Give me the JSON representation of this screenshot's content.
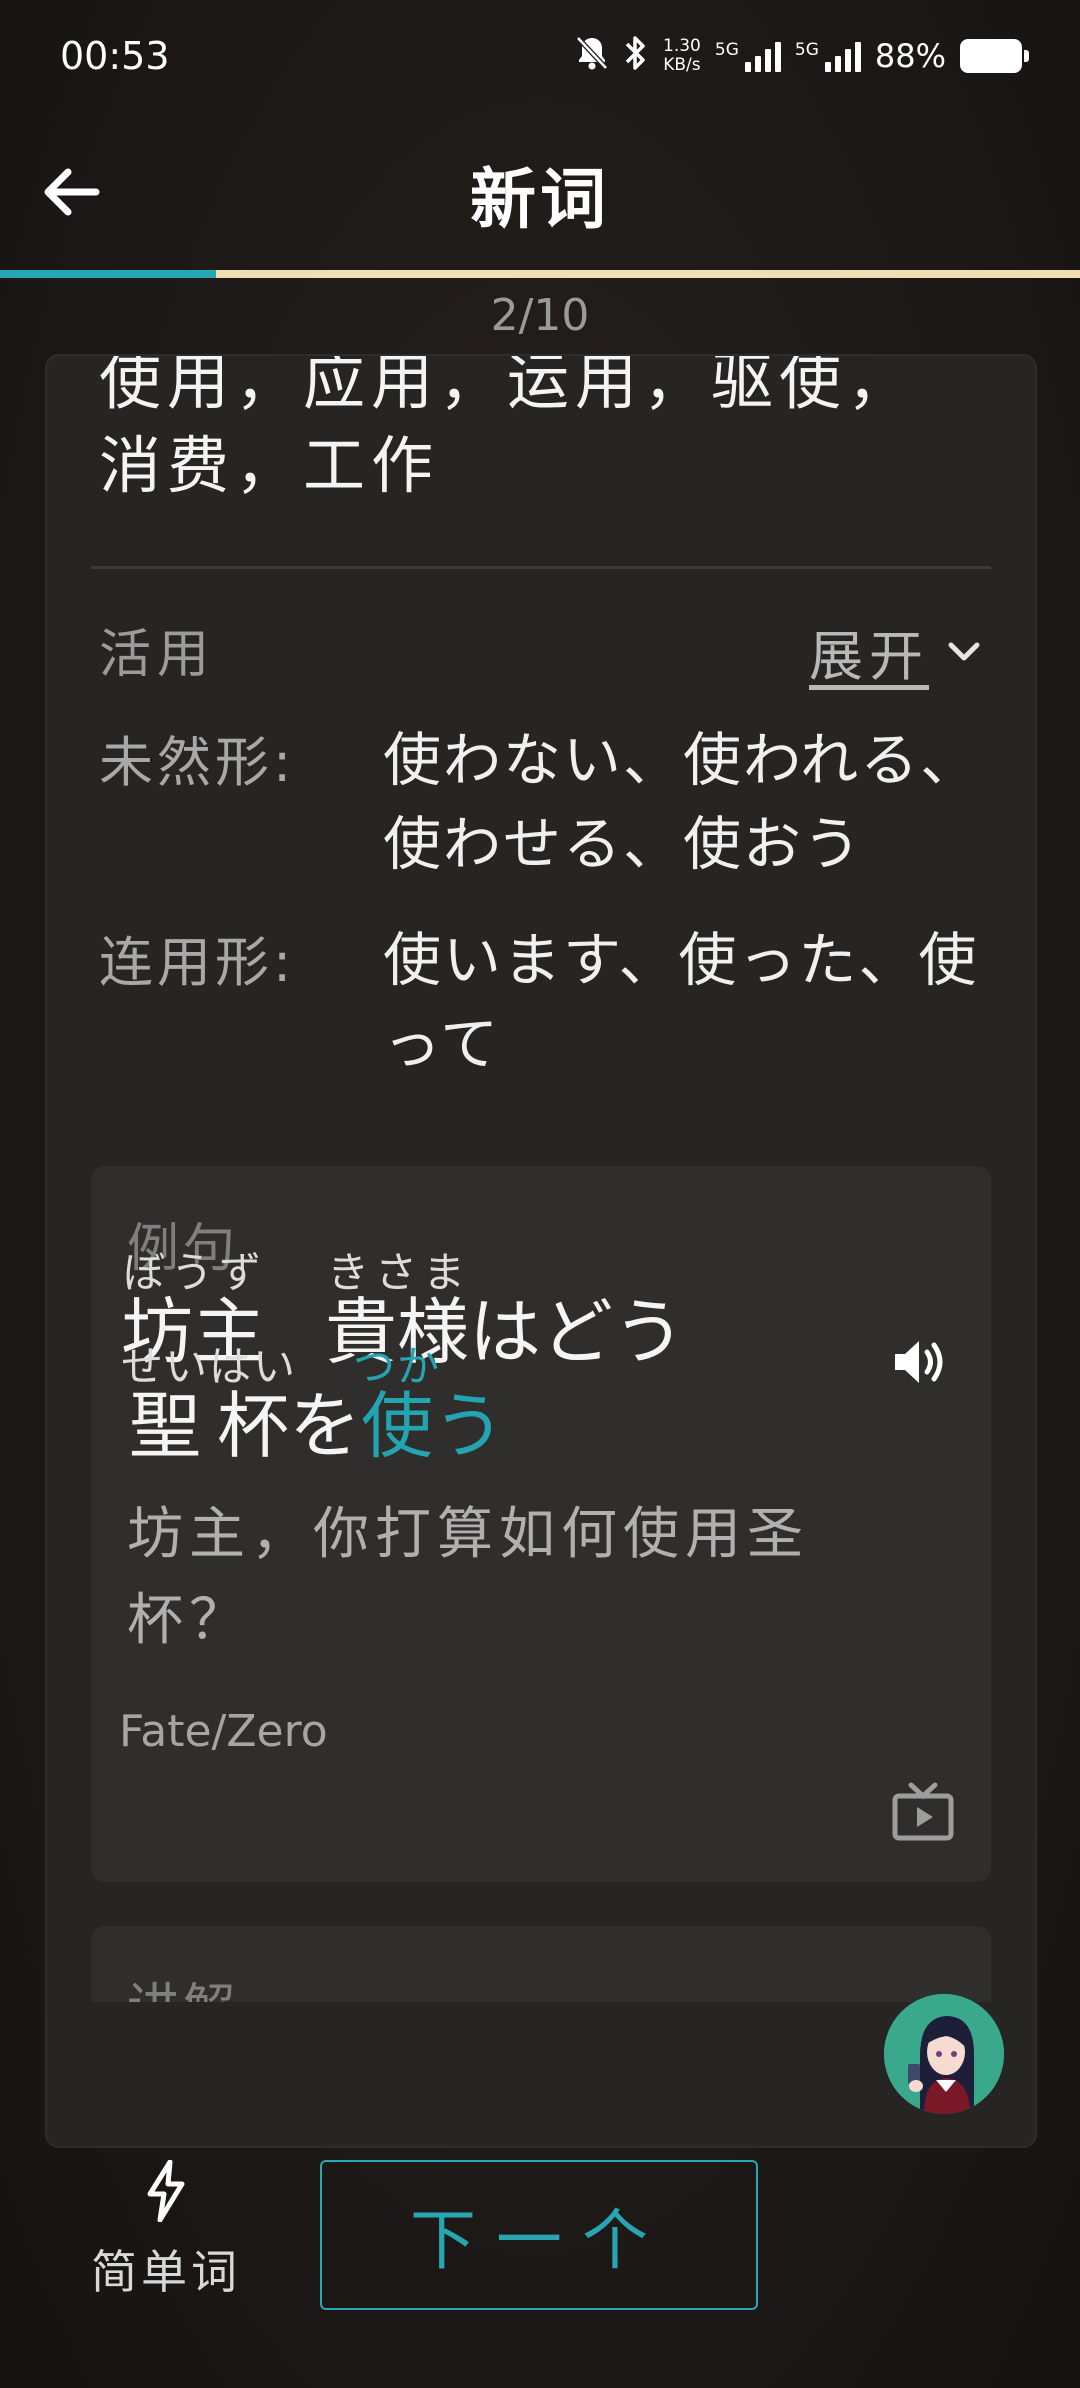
{
  "status_bar": {
    "time": "00:53",
    "speed_value": "1.30",
    "speed_unit": "KB/s",
    "sim1_label": "5G",
    "sim2_label": "5G",
    "battery": "88%"
  },
  "header": {
    "title": "新词"
  },
  "progress": {
    "fraction": 0.2,
    "counter": "2/10"
  },
  "card": {
    "meaning": "使用，应用，运用，驱使，消费，工作",
    "conjugation_section": {
      "title": "活用",
      "expand_label": "展开",
      "rows": [
        {
          "label": "未然形:",
          "forms": "使わない、使われる、使わせる、使おう"
        },
        {
          "label": "连用形:",
          "forms": "使います、使った、使って"
        }
      ]
    },
    "example": {
      "label": "例句",
      "line1": [
        {
          "kanji": "坊主",
          "reading": "ぼうず"
        },
        {
          "kanji": "貴様",
          "reading": "きさま"
        },
        {
          "text": "はどう"
        }
      ],
      "line2": [
        {
          "kanji": "聖杯",
          "reading": "せいはい"
        },
        {
          "text": "を"
        },
        {
          "kanji": "使",
          "reading": "つか",
          "highlight": true
        },
        {
          "text": "う",
          "highlight": true
        }
      ],
      "translation": "坊主，你打算如何使用圣杯？",
      "source": "Fate/Zero"
    },
    "explanation": {
      "label": "讲解"
    }
  },
  "bottom_bar": {
    "easy_label": "简单词",
    "next_label": "下一个"
  },
  "colors": {
    "accent": "#26a7b3",
    "progress_rest": "#efe0b4"
  }
}
